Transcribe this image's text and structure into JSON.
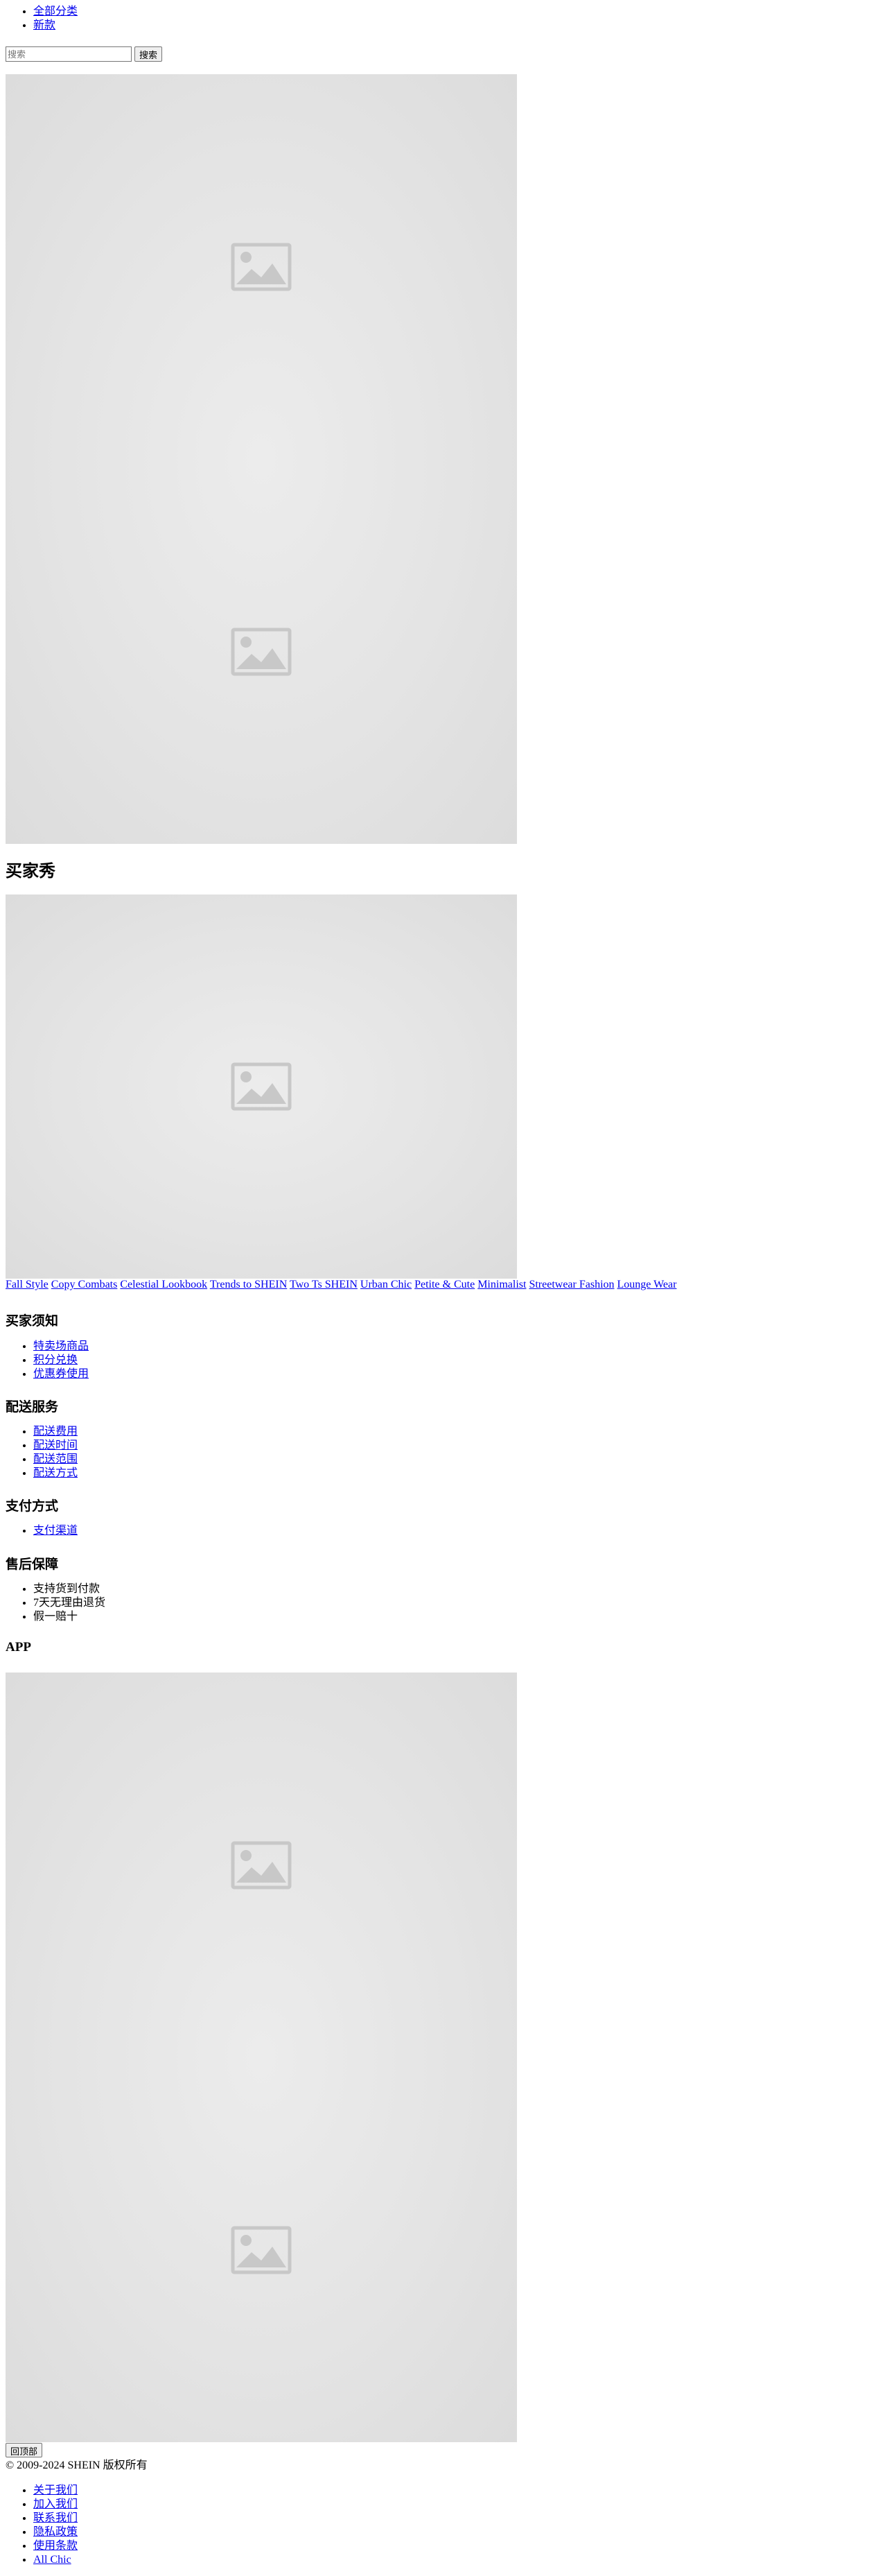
{
  "nav": {
    "items": [
      {
        "label": "全部分类"
      },
      {
        "label": "新款"
      }
    ]
  },
  "search": {
    "placeholder": "搜索",
    "value": "",
    "button_label": "搜索"
  },
  "banner": {
    "icon": "broken-image-icon"
  },
  "buyer_show": {
    "heading": "买家秀",
    "icon": "broken-image-icon"
  },
  "tags": [
    "Fall Style",
    "Copy Combats",
    "Celestial Lookbook",
    "Trends to SHEIN",
    "Two Ts SHEIN",
    "Urban Chic",
    "Petite & Cute",
    "Minimalist",
    "Streetwear Fashion",
    "Lounge Wear"
  ],
  "footer": {
    "buyer_notice": {
      "title": "买家须知",
      "links": [
        "特卖场商品",
        "积分兑换",
        "优惠券使用"
      ]
    },
    "delivery": {
      "title": "配送服务",
      "links": [
        "配送费用",
        "配送时间",
        "配送范围",
        "配送方式"
      ]
    },
    "payment": {
      "title": "支付方式",
      "links": [
        "支付渠道"
      ]
    },
    "after_sales": {
      "title": "售后保障",
      "items": [
        "支持货到付款",
        "7天无理由退货",
        "假一赔十"
      ]
    },
    "app": {
      "title": "APP",
      "icon": "broken-image-icon"
    }
  },
  "back_to_top_label": "回顶部",
  "copyright": "© 2009-2024 SHEIN 版权所有",
  "legal_links": [
    "关于我们",
    "加入我们",
    "联系我们",
    "隐私政策",
    "使用条款",
    "All Chic"
  ]
}
